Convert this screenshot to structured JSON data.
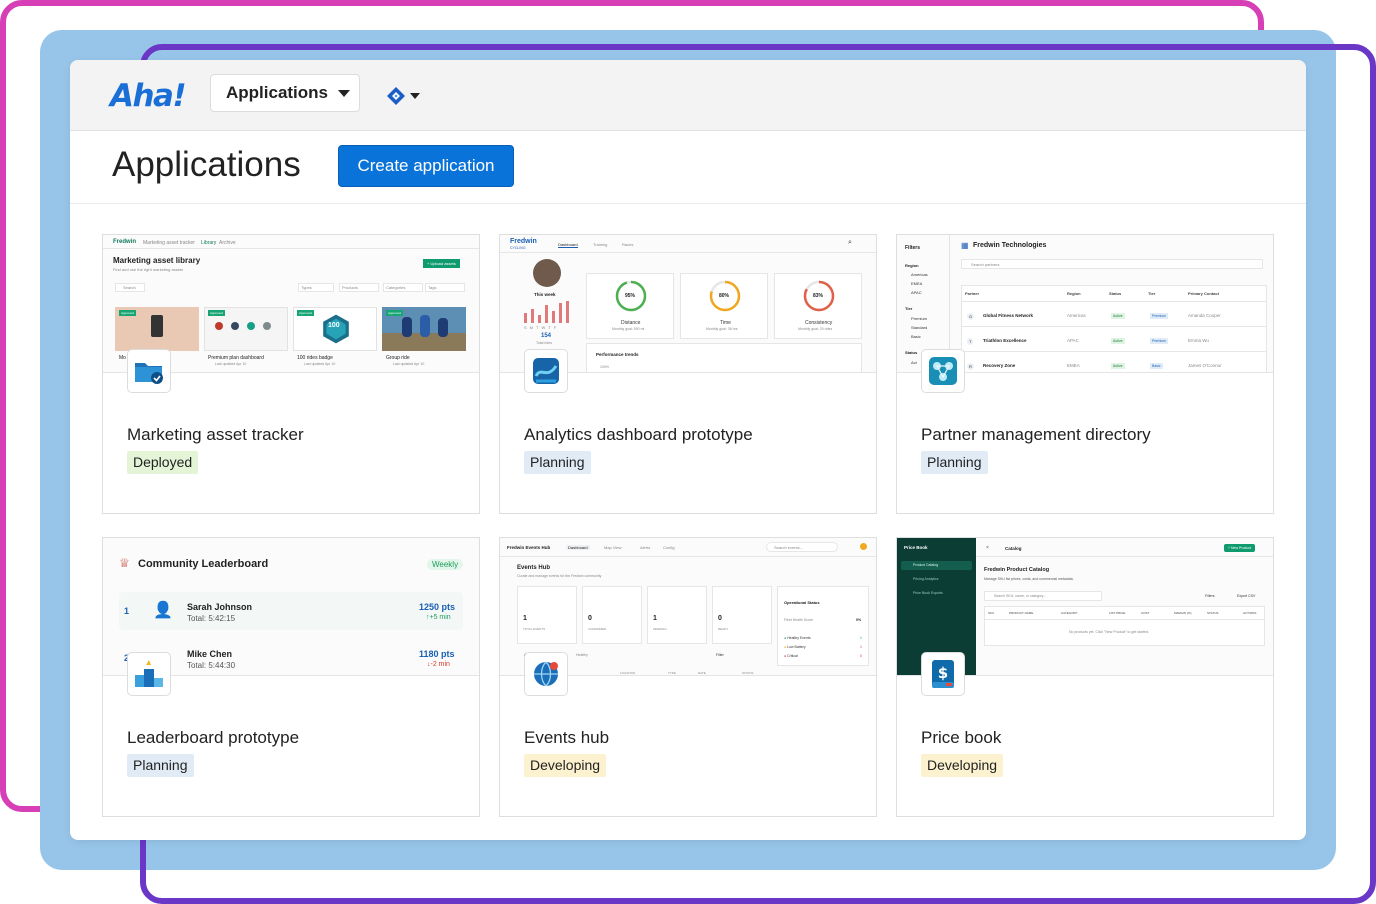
{
  "colors": {
    "brand": "#1a6fd6",
    "primary_button": "#0a73d9",
    "deployed": "#e3f4d7",
    "planning": "#e0ebf5",
    "developing": "#fcf2cf"
  },
  "topbar": {
    "logo": "Aha!",
    "workspace_label": "Applications",
    "integration_icon": "jira-icon"
  },
  "header": {
    "title": "Applications",
    "create_label": "Create application"
  },
  "cards": [
    {
      "name": "Marketing asset tracker",
      "status": "Deployed",
      "icon": "folder-check-icon",
      "preview": {
        "brand": "Fredwin",
        "nav": "Marketing asset tracker",
        "tabs": [
          "Library",
          "Archive"
        ],
        "heading": "Marketing asset library",
        "sub": "Find and use the right marketing assets",
        "upload": "+ Upload assets",
        "search": "Search",
        "filters": [
          "Types",
          "Products",
          "Categories",
          "Tags"
        ],
        "tiles": [
          "Mo",
          "Premium plan dashboard",
          "100 rides badge",
          "Group ride"
        ],
        "meta": "Last updated Apr 10",
        "tag": "Approved",
        "badge_num": "100"
      }
    },
    {
      "name": "Analytics dashboard prototype",
      "status": "Planning",
      "icon": "chart-cube-icon",
      "preview": {
        "brand": "Fredwin",
        "brand_sub": "CYCLING",
        "tabs": [
          "Dashboard",
          "Training",
          "Races"
        ],
        "week": "This week",
        "days": [
          "S",
          "M",
          "T",
          "W",
          "T",
          "F"
        ],
        "total": "154",
        "total_label": "Total rides",
        "gauges": [
          {
            "value": "95%",
            "label": "Distance",
            "sub": "Monthly goal: 500 mi",
            "pct": 95
          },
          {
            "value": "80%",
            "label": "Time",
            "sub": "Monthly goal: 36 hrs",
            "pct": 80
          },
          {
            "value": "83%",
            "label": "Consistency",
            "sub": "Monthly goal: 20 rides",
            "pct": 83
          }
        ],
        "trends": "Performance trends",
        "trends_val": "100%"
      }
    },
    {
      "name": "Partner management directory",
      "status": "Planning",
      "icon": "people-network-icon",
      "preview": {
        "filters_title": "Filters",
        "region_label": "Region",
        "regions": [
          "Americas",
          "EMEA",
          "APAC"
        ],
        "tier_label": "Tier",
        "tiers": [
          "Premium",
          "Standard",
          "Basic"
        ],
        "status_label": "Status",
        "status_item": "Act",
        "company": "Fredwin Technologies",
        "search": "Search partners",
        "columns": [
          "Partner",
          "Region",
          "Status",
          "Tier",
          "Primary Contact"
        ],
        "rows": [
          {
            "initial": "G",
            "partner": "Global Fitness Network",
            "region": "Americas",
            "status": "Active",
            "tier": "Premium",
            "contact": "Amanda Cooper"
          },
          {
            "initial": "T",
            "partner": "Triathlon Excellence",
            "region": "APAC",
            "status": "Active",
            "tier": "Premium",
            "contact": "Emma Wu"
          },
          {
            "initial": "R",
            "partner": "Recovery Zone",
            "region": "EMEA",
            "status": "Active",
            "tier": "Basic",
            "contact": "James O'Connor"
          }
        ]
      }
    },
    {
      "name": "Leaderboard prototype",
      "status": "Planning",
      "icon": "podium-icon",
      "preview": {
        "title": "Community Leaderboard",
        "period": "Weekly",
        "rows": [
          {
            "rank": "1",
            "name": "Sarah Johnson",
            "total": "Total: 5:42:15",
            "pts": "1250 pts",
            "delta": "↑+5 min"
          },
          {
            "rank": "2",
            "name": "Mike Chen",
            "total": "Total: 5:44:30",
            "pts": "1180 pts",
            "delta": "↓-2 min"
          }
        ]
      }
    },
    {
      "name": "Events hub",
      "status": "Developing",
      "icon": "globe-ticket-icon",
      "preview": {
        "brand": "Fredwin Events Hub",
        "tabs": [
          "Dashboard",
          "Map View",
          "Alerts",
          "Config"
        ],
        "search": "Search events...",
        "title": "Events Hub",
        "sub": "Curate and manage events for the Fredwin community",
        "stats": [
          {
            "value": "1",
            "label": "TOTAL EVENTS"
          },
          {
            "value": "0",
            "label": "CONFIRMED"
          },
          {
            "value": "1",
            "label": "PENDING"
          },
          {
            "value": "0",
            "label": "READY"
          }
        ],
        "status_title": "Operational Status",
        "health": "Fleet Health Score",
        "health_val": "0%",
        "legend": [
          "Healthy Events",
          "Low Battery",
          "Critical"
        ],
        "legend_vals": [
          "1",
          "1",
          "0"
        ],
        "list_tabs": [
          "All Events",
          "Healthy"
        ],
        "filter": "Filter",
        "columns": [
          "LOCATION",
          "TYPE",
          "DATE",
          "STATUS"
        ]
      }
    },
    {
      "name": "Price book",
      "status": "Developing",
      "icon": "dollar-book-icon",
      "preview": {
        "app": "Price Book",
        "nav": [
          "Product Catalog",
          "Pricing Analytics",
          "Price Book Exports"
        ],
        "crumb": "Catalog",
        "new": "+ New Product",
        "title": "Fredwin Product Catalog",
        "sub": "Manage SKU list prices, costs, and commercial metadata.",
        "search": "Search SKU, name, or category...",
        "filters": "Filters",
        "export": "Export CSV",
        "columns": [
          "SKU",
          "PRODUCT NAME",
          "CATEGORY",
          "LIST PRICE",
          "COST",
          "MARGIN (%)",
          "STATUS",
          "ACTIONS"
        ],
        "empty": "No products yet. Click \"New Product\" to get started."
      }
    }
  ]
}
